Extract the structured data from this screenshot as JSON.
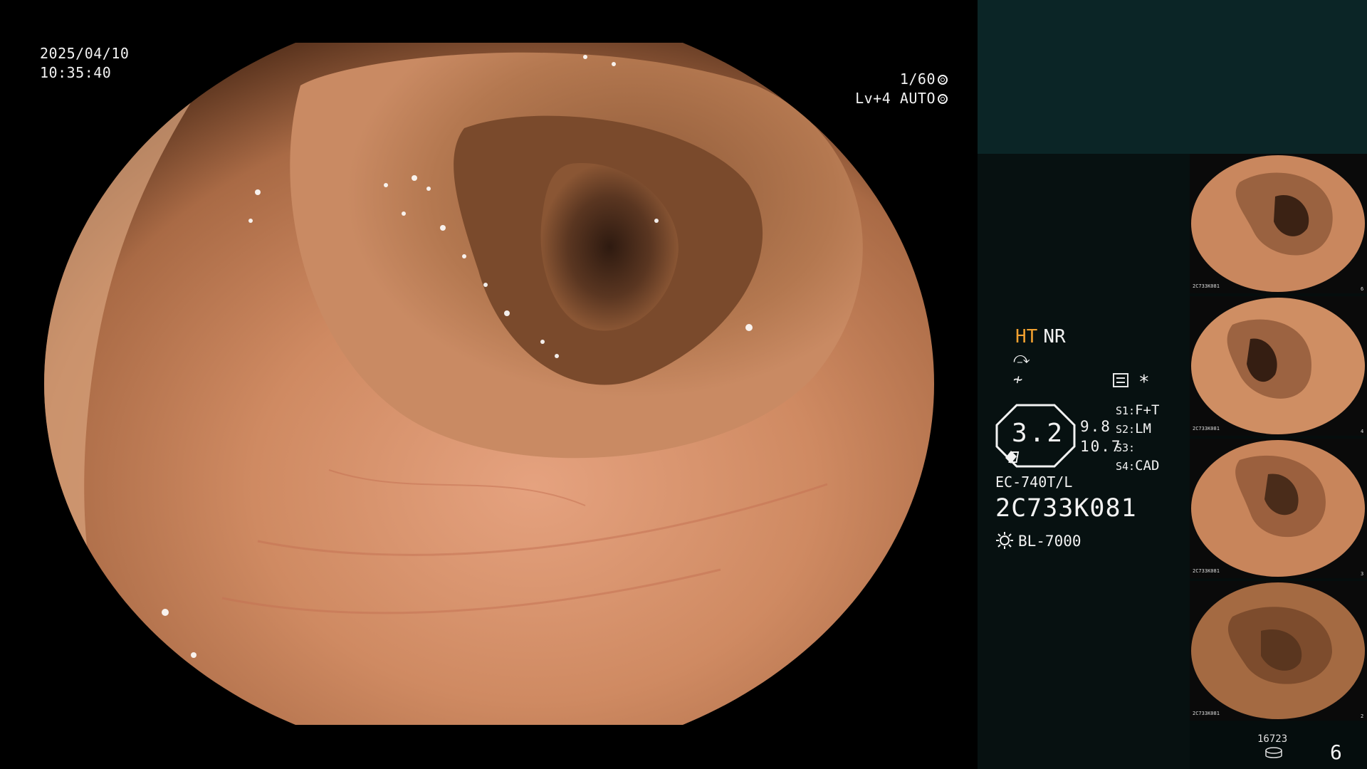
{
  "overlay": {
    "date": "2025/04/10",
    "time": "10:35:40",
    "shutter": "1/60",
    "level": "Lv+4 AUTO"
  },
  "panel": {
    "mode_ht": "HT",
    "mode_nr": "NR",
    "symbol_1": "⤼",
    "symbol_2": "≁",
    "star": "*",
    "zoom_value": "3.2",
    "zoom_a": "9.8",
    "zoom_b": "10.7",
    "switches": [
      {
        "key": "S1:",
        "value": "F+T"
      },
      {
        "key": "S2:",
        "value": "LM"
      },
      {
        "key": "S3:",
        "value": ""
      },
      {
        "key": "S4:",
        "value": "CAD"
      }
    ],
    "scope_model": "EC-740T/L",
    "scope_serial": "2C733K081",
    "light_source": "BL-7000",
    "disk_count": "16723",
    "page_number": "6"
  },
  "thumbnails": [
    {
      "label": "2C733K081",
      "index": "6"
    },
    {
      "label": "2C733K081",
      "index": "4"
    },
    {
      "label": "2C733K081",
      "index": "3"
    },
    {
      "label": "2C733K081",
      "index": "2"
    }
  ],
  "colors": {
    "ht_accent": "#f0a030",
    "panel_top": "#0b2526",
    "panel_info": "#071111",
    "mucosa": "#c98a63"
  }
}
